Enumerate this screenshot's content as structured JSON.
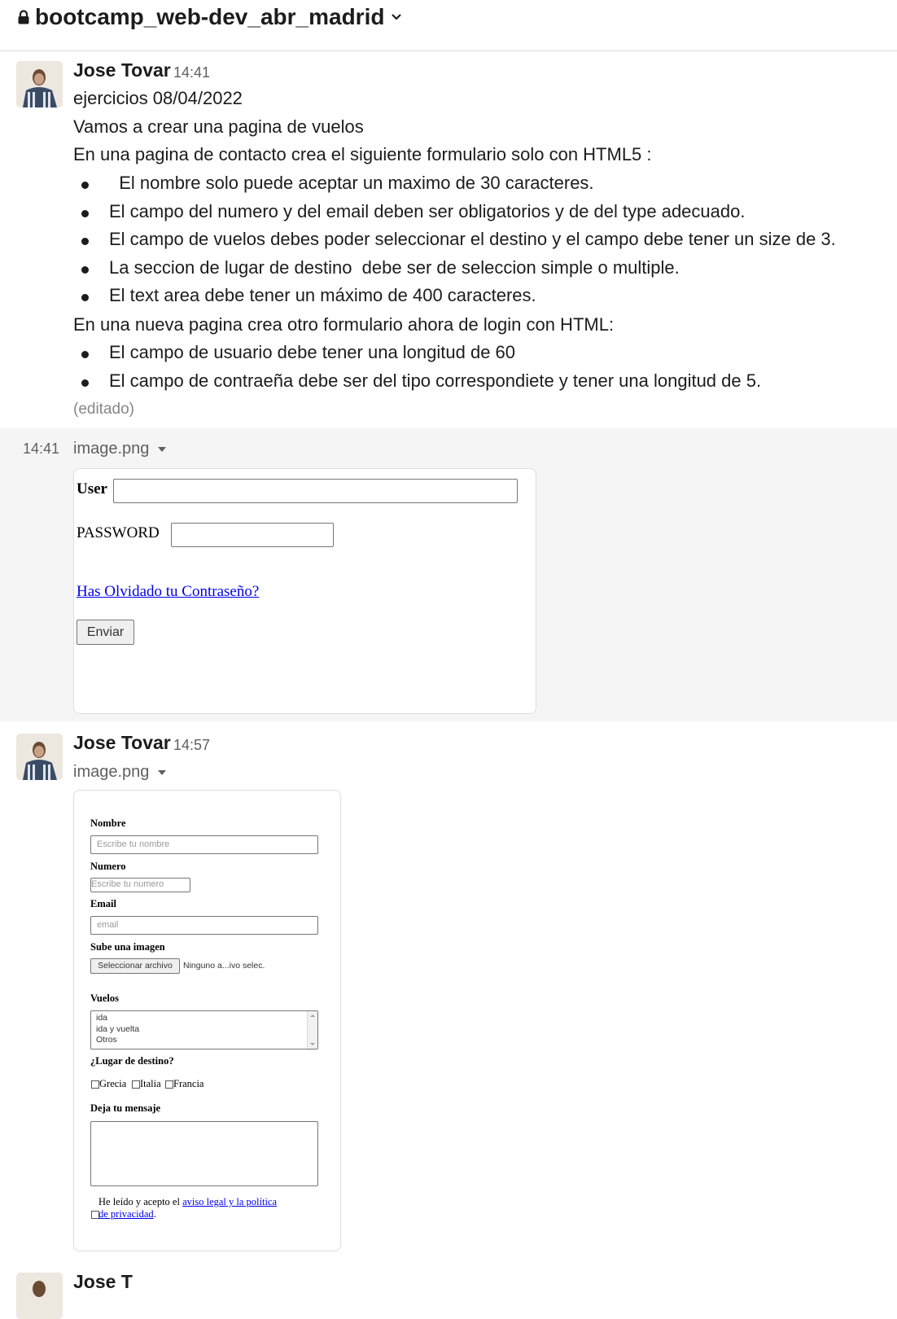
{
  "channel": {
    "name": "bootcamp_web-dev_abr_madrid"
  },
  "messages": [
    {
      "author": "Jose Tovar",
      "time": "14:41",
      "lines": [
        "ejercicios 08/04/2022",
        "Vamos a crear una pagina de vuelos",
        "En una pagina de contacto crea el siguiente formulario solo con HTML5 :"
      ],
      "bullets1": [
        "  El nombre solo puede aceptar un maximo de 30 caracteres.",
        "El campo del numero y del email deben ser obligatorios y de del type adecuado.",
        "El campo de vuelos debes poder seleccionar el destino y el campo debe tener un size de 3.",
        "La seccion de lugar de destino  debe ser de seleccion simple o multiple.",
        "El text area debe tener un máximo de 400 caracteres."
      ],
      "line_after": "En una nueva pagina crea otro formulario ahora de login con HTML:",
      "bullets2": [
        "El campo de usuario debe tener una longitud de 60",
        "El campo de contraeña debe ser del tipo correspondiete y tener una longitud de 5."
      ],
      "edited": "(editado)"
    },
    {
      "time": "14:41",
      "filename": "image.png",
      "login_form": {
        "user_label": "User",
        "password_label": "PASSWORD",
        "forgot_link": "Has Olvidado tu Contraseño?",
        "submit": "Enviar"
      }
    },
    {
      "author": "Jose Tovar",
      "time": "14:57",
      "filename": "image.png",
      "contact_form": {
        "nombre_label": "Nombre",
        "nombre_placeholder": "Escribe tu nombre",
        "numero_label": "Numero",
        "numero_placeholder": "Escribe tu numero",
        "email_label": "Email",
        "email_placeholder": "email",
        "imagen_label": "Sube una imagen",
        "file_button": "Seleccionar archivo",
        "file_status": "Ninguno a...ivo selec.",
        "vuelos_label": "Vuelos",
        "vuelos_options": [
          "ida",
          "ida y vuelta",
          "Otros"
        ],
        "destino_label": "¿Lugar de destino?",
        "destinos": [
          "Grecia",
          "Italia",
          "Francia"
        ],
        "mensaje_label": "Deja tu mensaje",
        "legal_prefix": "He leído y acepto el ",
        "legal_link_1": "aviso legal y la política",
        "legal_link_2": "de privacidad",
        "legal_suffix": "."
      }
    }
  ],
  "next_author": "Jose T"
}
